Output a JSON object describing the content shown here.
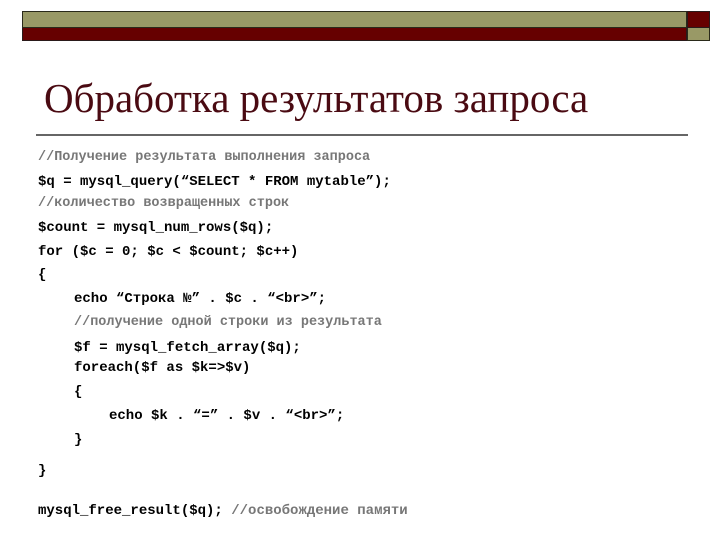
{
  "slide": {
    "title": "Обработка результатов запроса",
    "colors": {
      "olive": "#999966",
      "maroon": "#660000",
      "title": "#4a0a12",
      "comment": "#777777",
      "code": "#000000"
    },
    "code_lines": [
      {
        "text": "//Получение результата выполнения запроса",
        "kind": "comment"
      },
      {
        "text": "$q = mysql_query(“SELECT * FROM mytable”);",
        "kind": "code"
      },
      {
        "text": "//количество возвращенных строк",
        "kind": "comment"
      },
      {
        "text": "$count = mysql_num_rows($q);",
        "kind": "code"
      },
      {
        "text": "for ($c = 0; $c < $count; $c++)",
        "kind": "code"
      },
      {
        "text": "{",
        "kind": "code"
      },
      {
        "text": "echo “Строка №” . $c . “<br>”;",
        "kind": "code"
      },
      {
        "text": "//получение одной строки из результата",
        "kind": "comment"
      },
      {
        "text": "$f = mysql_fetch_array($q);",
        "kind": "code"
      },
      {
        "text": "foreach($f as $k=>$v)",
        "kind": "code"
      },
      {
        "text": "{",
        "kind": "code"
      },
      {
        "text": "echo $k . “=” . $v . “<br>”;",
        "kind": "code"
      },
      {
        "text": "}",
        "kind": "code"
      },
      {
        "text": "}",
        "kind": "code"
      },
      {
        "text": "mysql_free_result($q);",
        "kind": "code",
        "trailing_comment": " //освобождение памяти"
      }
    ]
  }
}
